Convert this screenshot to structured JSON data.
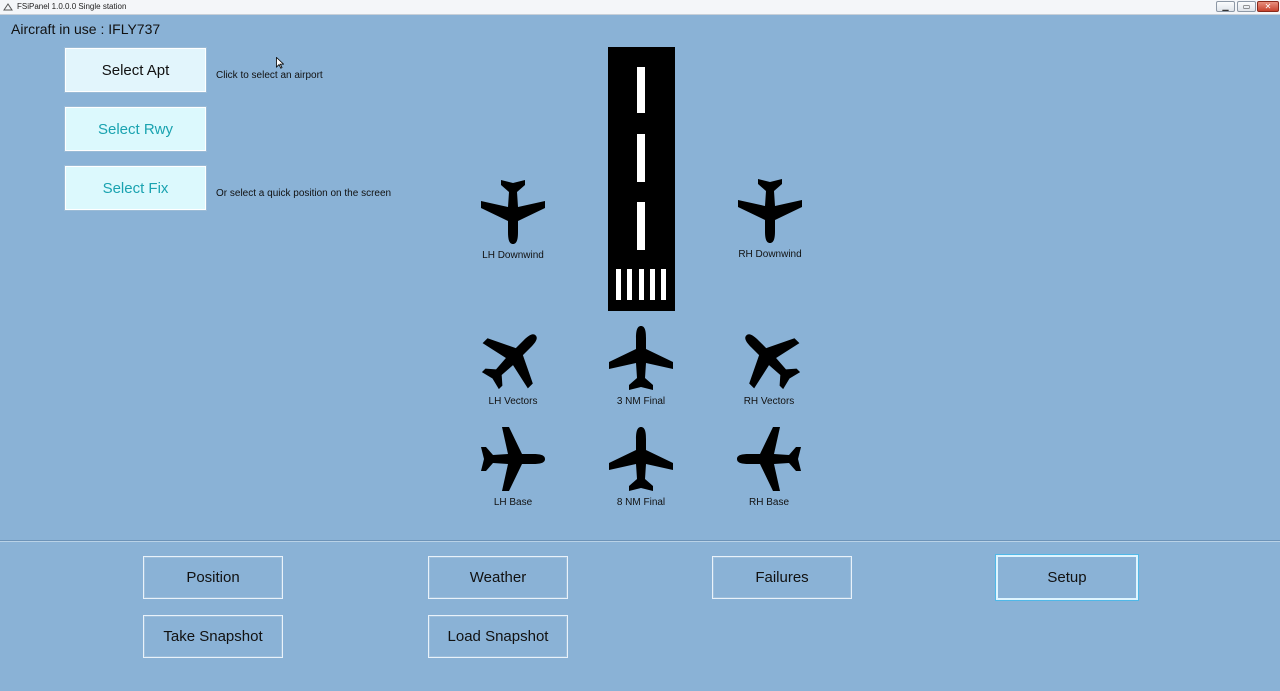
{
  "window": {
    "title": "FSiPanel 1.0.0.0 Single station",
    "controls": [
      "minimize",
      "maximize",
      "close"
    ]
  },
  "aircraft": {
    "label": "Aircraft in use : IFLY737"
  },
  "selectors": [
    {
      "label": "Select Apt",
      "hint": "Click to select an airport"
    },
    {
      "label": "Select Rwy"
    },
    {
      "label": "Select Fix",
      "hint": "Or select a quick position on the screen"
    }
  ],
  "positions": {
    "lh_downwind": "LH Downwind",
    "rh_downwind": "RH Downwind",
    "lh_vectors": "LH Vectors",
    "final_3nm": "3 NM Final",
    "rh_vectors": "RH Vectors",
    "lh_base": "LH Base",
    "final_8nm": "8 NM Final",
    "rh_base": "RH Base"
  },
  "nav": {
    "position": "Position",
    "weather": "Weather",
    "failures": "Failures",
    "setup": "Setup",
    "take_snapshot": "Take Snapshot",
    "load_snapshot": "Load Snapshot"
  },
  "colors": {
    "background": "#8ab2d6",
    "select_apt_bg": "#e2f5fc",
    "select_secondary_text": "#1aa3b0",
    "setup_focus_border": "#4fb8e8"
  }
}
